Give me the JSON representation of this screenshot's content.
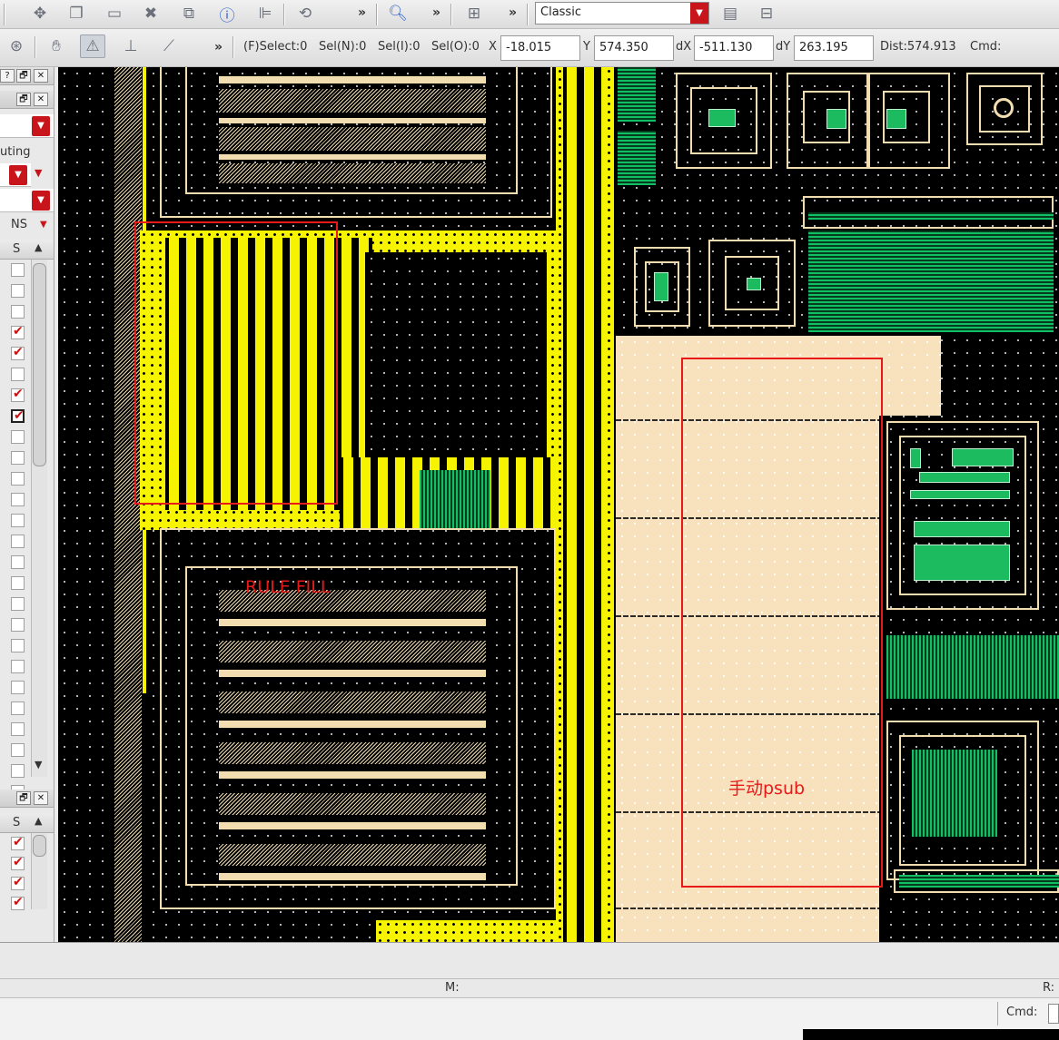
{
  "toolbar": {
    "view_mode": "Classic",
    "more": "»"
  },
  "status": {
    "fselect": "(F)Select:0",
    "sel_n": "Sel(N):0",
    "sel_i": "Sel(I):0",
    "sel_o": "Sel(O):0",
    "x_label": "X",
    "x_value": "-18.015",
    "y_label": "Y",
    "y_value": "574.350",
    "dx_label": "dX",
    "dx_value": "-511.130",
    "dy_label": "dY",
    "dy_value": "263.195",
    "dist": "Dist:574.913",
    "cmd": "Cmd:"
  },
  "left_panel": {
    "title_btn_help": "?",
    "title_btn_float": "🗗",
    "title_btn_close": "✕",
    "routing_label": "uting",
    "ns_label": "NS",
    "s_column": "S",
    "layer_checks": [
      false,
      false,
      false,
      true,
      true,
      false,
      true,
      true,
      false,
      false,
      false,
      false,
      false,
      false,
      false,
      false,
      false,
      false,
      false,
      false,
      false,
      false,
      false,
      false,
      false,
      false
    ],
    "lower_checks": [
      true,
      true,
      true,
      true
    ]
  },
  "canvas": {
    "label_rule_fill": "RULE FILL",
    "label_psub": "手动psub"
  },
  "bottom": {
    "m_label": "M:",
    "r_label": "R:",
    "cmd_label": "Cmd:"
  },
  "colors": {
    "canvas_bg": "#000000",
    "metal_yellow": "#f7f400",
    "diffusion_tan": "#f2ddb0",
    "implant_green": "#11c064",
    "psub_cream": "#f7e2bd",
    "annotation_red": "#e81919"
  }
}
